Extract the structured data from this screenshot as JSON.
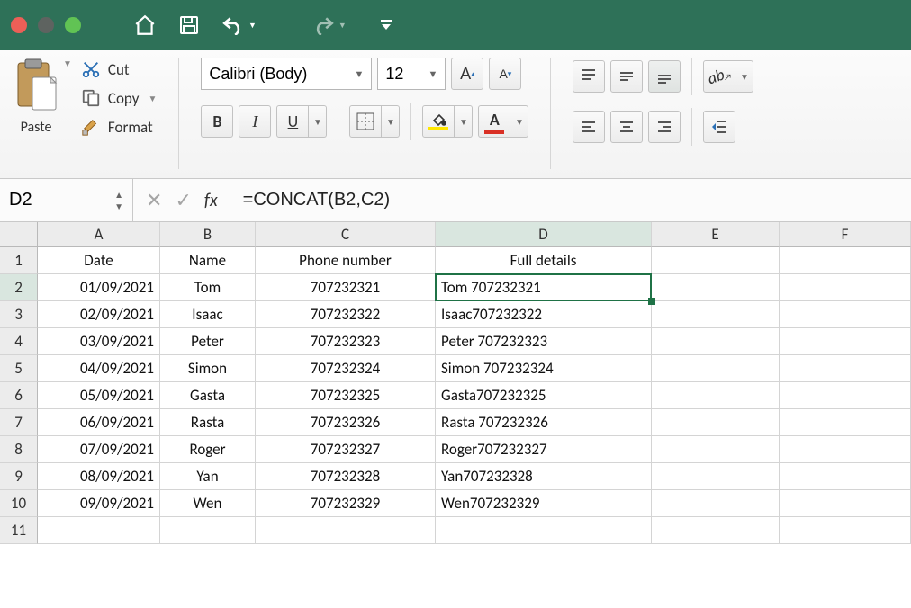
{
  "traffic_colors": {
    "close": "#ec5f57",
    "min": "#5e6360",
    "max": "#61c354"
  },
  "toolbar": {
    "paste_label": "Paste",
    "cut_label": "Cut",
    "copy_label": "Copy",
    "format_label": "Format",
    "font_name": "Calibri (Body)",
    "font_size": "12",
    "bold": "B",
    "italic": "I",
    "underline": "U",
    "font_color_letter": "A",
    "fill_color": "#ffe600",
    "text_color": "#d93025"
  },
  "formula_bar": {
    "cell_ref": "D2",
    "formula": "=CONCAT(B2,C2)"
  },
  "columns": [
    "A",
    "B",
    "C",
    "D",
    "E",
    "F"
  ],
  "row_numbers": [
    1,
    2,
    3,
    4,
    5,
    6,
    7,
    8,
    9,
    10,
    11
  ],
  "headers": {
    "A": "Date",
    "B": "Name",
    "C": "Phone number",
    "D": "Full details"
  },
  "rows": [
    {
      "A": "01/09/2021",
      "B": "Tom",
      "C": "707232321",
      "D": "Tom 707232321"
    },
    {
      "A": "02/09/2021",
      "B": "Isaac",
      "C": "707232322",
      "D": "Isaac707232322"
    },
    {
      "A": "03/09/2021",
      "B": "Peter",
      "C": "707232323",
      "D": "Peter 707232323"
    },
    {
      "A": "04/09/2021",
      "B": "Simon",
      "C": "707232324",
      "D": "Simon 707232324"
    },
    {
      "A": "05/09/2021",
      "B": "Gasta",
      "C": "707232325",
      "D": "Gasta707232325"
    },
    {
      "A": "06/09/2021",
      "B": "Rasta",
      "C": "707232326",
      "D": "Rasta 707232326"
    },
    {
      "A": "07/09/2021",
      "B": "Roger",
      "C": "707232327",
      "D": "Roger707232327"
    },
    {
      "A": "08/09/2021",
      "B": "Yan",
      "C": "707232328",
      "D": "Yan707232328"
    },
    {
      "A": "09/09/2021",
      "B": "Wen",
      "C": "707232329",
      "D": "Wen707232329"
    }
  ],
  "selection": {
    "col": "D",
    "row": 2
  }
}
